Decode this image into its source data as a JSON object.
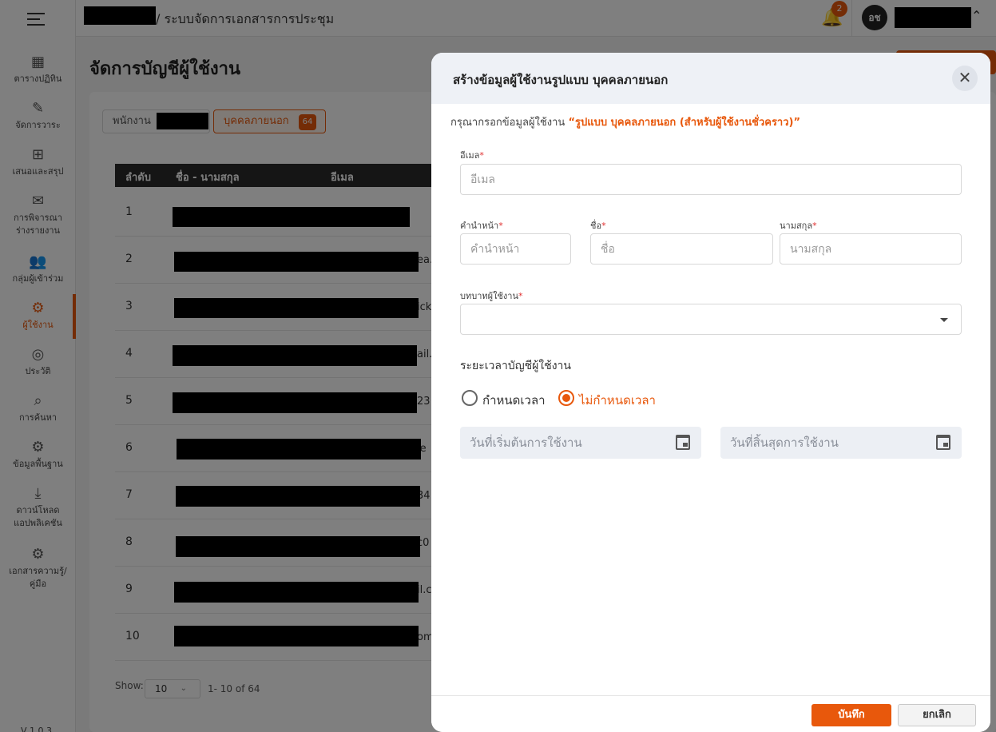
{
  "colors": {
    "accent": "#e8580c",
    "dark_header": "#2b2b2b",
    "required": "#e03030"
  },
  "topbar": {
    "breadcrumb": "/ ระบบจัดการเอกสารการประชุม",
    "notification_count": "2",
    "avatar_initials": "อช",
    "icons": {
      "menu": "hamburger-icon",
      "bell": "bell-icon",
      "caret": "chevron-up-icon"
    }
  },
  "sidebar": {
    "items": [
      {
        "label": "ตารางปฏิทิน",
        "icon": "calendar-icon",
        "glyph": "▦"
      },
      {
        "label": "จัดการวาระ",
        "icon": "edit-icon",
        "glyph": "✎"
      },
      {
        "label": "เสนอและสรุป",
        "icon": "add-box-icon",
        "glyph": "⊞"
      },
      {
        "label": "การพิจารณา",
        "label2": "ร่างรายงาน",
        "icon": "comment-add-icon",
        "glyph": "✉"
      },
      {
        "label": "กลุ่มผู้เข้าร่วม",
        "icon": "group-icon",
        "glyph": "👥"
      },
      {
        "label": "ผู้ใช้งาน",
        "icon": "user-settings-icon",
        "glyph": "⚙"
      },
      {
        "label": "ประวัติ",
        "icon": "history-icon",
        "glyph": "◎"
      },
      {
        "label": "การค้นหา",
        "icon": "search-doc-icon",
        "glyph": "⌕"
      },
      {
        "label": "ข้อมูลพื้นฐาน",
        "icon": "gear-icon",
        "glyph": "⚙"
      },
      {
        "label": "ดาวน์โหลด",
        "label2": "แอปพลิเคชัน",
        "icon": "download-icon",
        "glyph": "⤓"
      },
      {
        "label": "เอกสารความรู้/",
        "label2": "คู่มือ",
        "icon": "gear-icon",
        "glyph": "⚙"
      }
    ],
    "version": "V 1.0.3"
  },
  "page": {
    "title": "จัดการบัญชีผู้ใช้งาน",
    "tabs": [
      {
        "label": "พนักงาน"
      },
      {
        "label": "บุคคลภายนอก",
        "count": "64"
      }
    ],
    "table": {
      "columns": [
        "ลำดับ",
        "ชื่อ - นามสกุล",
        "อีเมล"
      ],
      "rows": [
        {
          "num": "1",
          "tail": ""
        },
        {
          "num": "2",
          "tail": "ea."
        },
        {
          "num": "3",
          "tail": "ick"
        },
        {
          "num": "4",
          "tail": "ail."
        },
        {
          "num": "5",
          "tail": "23"
        },
        {
          "num": "6",
          "tail": "le"
        },
        {
          "num": "7",
          "tail": "34"
        },
        {
          "num": "8",
          "tail": "c0"
        },
        {
          "num": "9",
          "tail": "il.c"
        },
        {
          "num": "10",
          "tail": "om"
        }
      ]
    },
    "pager": {
      "show_label": "Show:",
      "page_size": "10",
      "range": "1- 10 of 64"
    }
  },
  "modal": {
    "title": "สร้างข้อมูลผู้ใช้งานรูปแบบ บุคคลภายนอก",
    "instruction_prefix": "กรุณากรอกข้อมูลผู้ใช้งาน",
    "instruction_highlight": "“รูปแบบ บุคคลภายนอก (สำหรับผู้ใช้งานชั่วคราว)”",
    "fields": {
      "email": {
        "label": "อีเมล",
        "placeholder": "อีเมล"
      },
      "prefix": {
        "label": "คำนำหน้า",
        "placeholder": "คำนำหน้า"
      },
      "first_name": {
        "label": "ชื่อ",
        "placeholder": "ชื่อ"
      },
      "last_name": {
        "label": "นามสกุล",
        "placeholder": "นามสกุล"
      },
      "role": {
        "label": "บทบาทผู้ใช้งาน",
        "value": ""
      }
    },
    "required_mark": "*",
    "duration": {
      "label": "ระยะเวลาบัญชีผู้ใช้งาน",
      "options": [
        "กำหนดเวลา",
        "ไม่กำหนดเวลา"
      ],
      "selected": "ไม่กำหนดเวลา"
    },
    "start_date_placeholder": "วันที่เริ่มต้นการใช้งาน",
    "end_date_placeholder": "วันที่สิ้นสุดการใช้งาน",
    "save_label": "บันทึก",
    "cancel_label": "ยกเลิก",
    "close_glyph": "✕"
  }
}
